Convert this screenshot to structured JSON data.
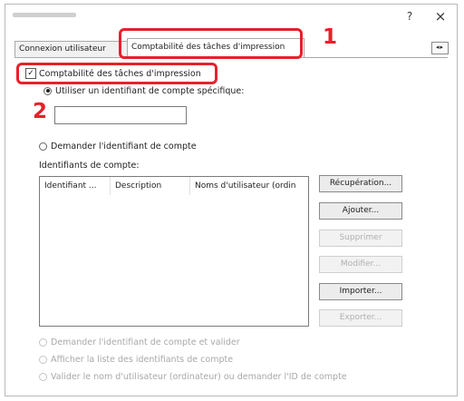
{
  "window": {
    "help_glyph": "?",
    "close_glyph": "×"
  },
  "tabs": [
    {
      "label": "Connexion utilisateur"
    },
    {
      "label": "Comptabilité des tâches d'impression"
    }
  ],
  "tab_scroll_glyph": "◂▸",
  "callouts": {
    "one": "1",
    "two": "2"
  },
  "accounting": {
    "enable_label": "Comptabilité des tâches d'impression",
    "enable_checked": "✓"
  },
  "options": {
    "use_specific_label": "Utiliser un identifiant de compte spécifique:",
    "account_id_value": "",
    "prompt_label": "Demander l'identifiant de compte",
    "ids_label": "Identifiants de compte:"
  },
  "list": {
    "columns": [
      "Identifiant ...",
      "Description",
      "Noms d'utilisateur (ordin"
    ]
  },
  "buttons": {
    "recuperation": "Récupération...",
    "ajouter": "Ajouter...",
    "supprimer": "Supprimer",
    "modifier": "Modifier...",
    "importer": "Importer...",
    "exporter": "Exporter..."
  },
  "bottom_options": {
    "validate": "Demander l'identifiant de compte et valider",
    "show_list": "Afficher la liste des identifiants de compte",
    "username": "Valider le nom d'utilisateur (ordinateur) ou demander l'ID de compte"
  }
}
